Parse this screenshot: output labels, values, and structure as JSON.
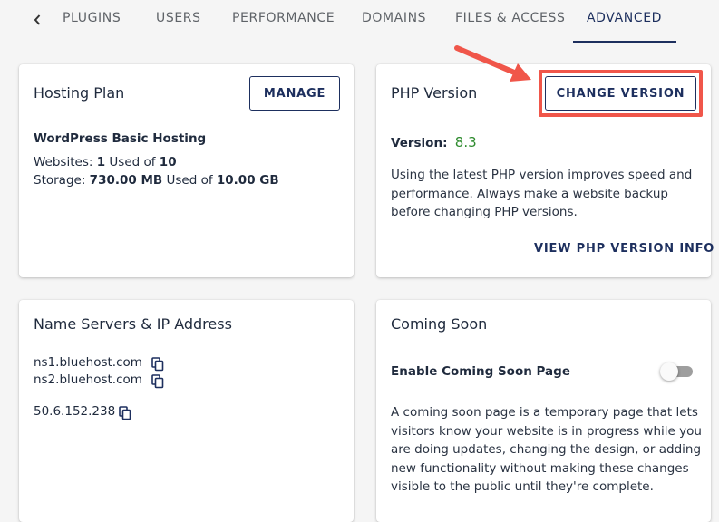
{
  "tabs": {
    "items": [
      {
        "label": "PLUGINS"
      },
      {
        "label": "USERS"
      },
      {
        "label": "PERFORMANCE"
      },
      {
        "label": "DOMAINS"
      },
      {
        "label": "FILES & ACCESS"
      },
      {
        "label": "ADVANCED"
      }
    ],
    "active": "ADVANCED"
  },
  "hosting_plan": {
    "title": "Hosting Plan",
    "manage_label": "MANAGE",
    "plan_name": "WordPress Basic Hosting",
    "websites_label": "Websites:",
    "websites_used": "1",
    "websites_used_of": "Used of",
    "websites_total": "10",
    "storage_label": "Storage:",
    "storage_used": "730.00 MB",
    "storage_used_of": "Used of",
    "storage_total": "10.00 GB"
  },
  "php_version": {
    "title": "PHP Version",
    "change_label": "CHANGE VERSION",
    "version_label": "Version:",
    "version_value": "8.3",
    "description": "Using the latest PHP version improves speed and performance. Always make a website backup before changing PHP versions.",
    "info_link": "VIEW PHP VERSION INFO"
  },
  "name_servers": {
    "title": "Name Servers & IP Address",
    "servers": [
      "ns1.bluehost.com",
      "ns2.bluehost.com"
    ],
    "ip_address": "50.6.152.238"
  },
  "coming_soon": {
    "title": "Coming Soon",
    "toggle_label": "Enable Coming Soon Page",
    "toggle_on": false,
    "description": "A coming soon page is a temporary page that lets visitors know your website is in progress while you are doing updates, changing the design, or adding new functionality without making these changes visible to the public until they're complete."
  },
  "colors": {
    "accent": "#1d2f5e",
    "version_green": "#2e8b2e",
    "highlight": "#f0564a"
  }
}
